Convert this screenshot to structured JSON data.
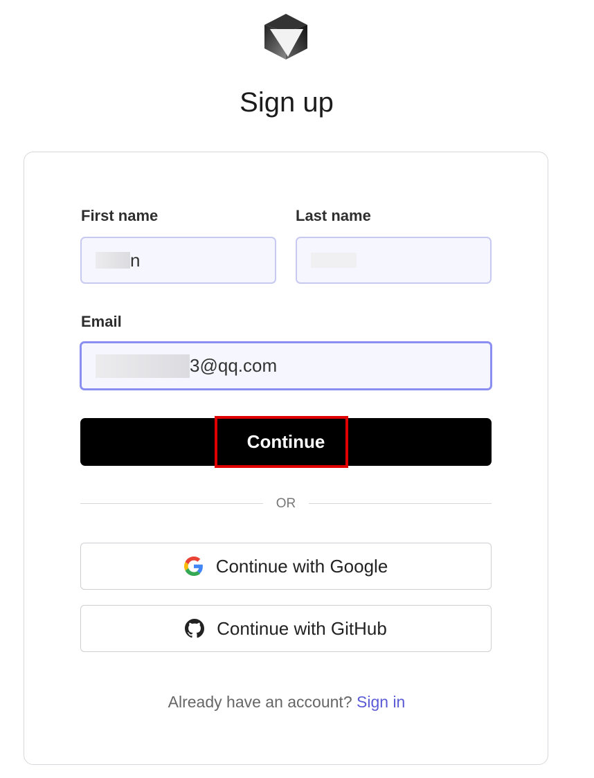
{
  "logo": {
    "icon": "cube-logo"
  },
  "page_title": "Sign up",
  "form": {
    "first_name_label": "First name",
    "first_name_value": "n",
    "last_name_label": "Last name",
    "last_name_value": "",
    "email_label": "Email",
    "email_value_visible": "3@qq.com",
    "continue_label": "Continue"
  },
  "divider_text": "OR",
  "social": {
    "google_label": "Continue with Google",
    "github_label": "Continue with GitHub"
  },
  "footer": {
    "prompt": "Already have an account?",
    "signin_label": "Sign in"
  },
  "colors": {
    "accent": "#5b5bd6",
    "primary_button": "#000000",
    "highlight": "#e00000",
    "input_bg": "#f6f6fe"
  }
}
